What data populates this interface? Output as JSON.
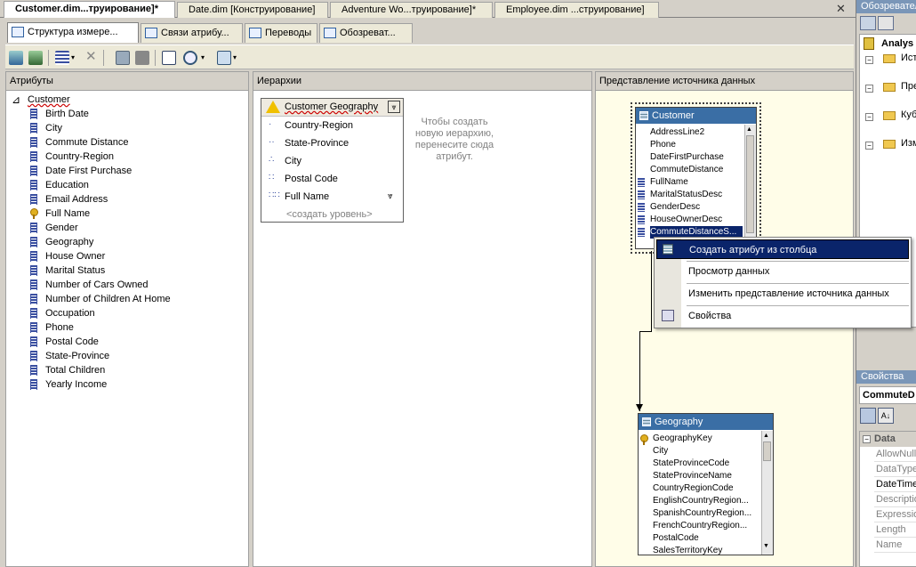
{
  "doc_tabs": [
    {
      "label": "Customer.dim...труирование]*",
      "active": true
    },
    {
      "label": "Date.dim [Конструирование]",
      "active": false
    },
    {
      "label": "Adventure Wo...труирование]*",
      "active": false
    },
    {
      "label": "Employee.dim ...струирование]",
      "active": false
    }
  ],
  "close_glyph": "✕",
  "sub_tabs": [
    {
      "label": "Структура измере...",
      "active": true
    },
    {
      "label": "Связи атрибу...",
      "active": false
    },
    {
      "label": "Переводы",
      "active": false
    },
    {
      "label": "Обозреват...",
      "active": false
    }
  ],
  "panes": {
    "attributes": "Атрибуты",
    "hierarchies": "Иерархии",
    "dsv": "Представление источника данных"
  },
  "dimension": {
    "name": "Customer",
    "attributes": [
      "Birth Date",
      "City",
      "Commute Distance",
      "Country-Region",
      "Date First Purchase",
      "Education",
      "Email Address",
      "Full Name",
      "Gender",
      "Geography",
      "House Owner",
      "Marital Status",
      "Number of Cars Owned",
      "Number of Children At Home",
      "Occupation",
      "Phone",
      "Postal Code",
      "State-Province",
      "Total Children",
      "Yearly Income"
    ],
    "key_attribute": "Full Name"
  },
  "hierarchy": {
    "name": "Customer Geography",
    "levels": [
      "Country-Region",
      "State-Province",
      "City",
      "Postal Code",
      "Full Name"
    ],
    "new_level": "<создать уровень>",
    "hint": "Чтобы создать новую иерархию, перенесите сюда атрибут."
  },
  "tables": {
    "customer": {
      "name": "Customer",
      "columns": [
        "AddressLine2",
        "Phone",
        "DateFirstPurchase",
        "CommuteDistance",
        "FullName",
        "MaritalStatusDesc",
        "GenderDesc",
        "HouseOwnerDesc",
        "CommuteDistanceS..."
      ],
      "selected": "CommuteDistanceS..."
    },
    "geography": {
      "name": "Geography",
      "columns": [
        "GeographyKey",
        "City",
        "StateProvinceCode",
        "StateProvinceName",
        "CountryRegionCode",
        "EnglishCountryRegion...",
        "SpanishCountryRegion...",
        "FrenchCountryRegion...",
        "PostalCode",
        "SalesTerritoryKey"
      ],
      "key": "GeographyKey"
    }
  },
  "context_menu": {
    "items": [
      "Создать атрибут из столбца",
      "Просмотр данных",
      "Изменить представление источника данных",
      "Свойства"
    ],
    "highlighted": "Создать атрибут из столбца"
  },
  "solution_explorer": {
    "title": "Обозреватель",
    "root": "Analys",
    "nodes": [
      "Ист",
      "Пре",
      "Куб",
      "Изм"
    ]
  },
  "properties": {
    "title": "Свойства",
    "object": "CommuteD",
    "category": "Data",
    "rows": [
      "AllowNull",
      "DataType",
      "DateTimeM",
      "Description",
      "Expression",
      "Length",
      "Name"
    ]
  }
}
